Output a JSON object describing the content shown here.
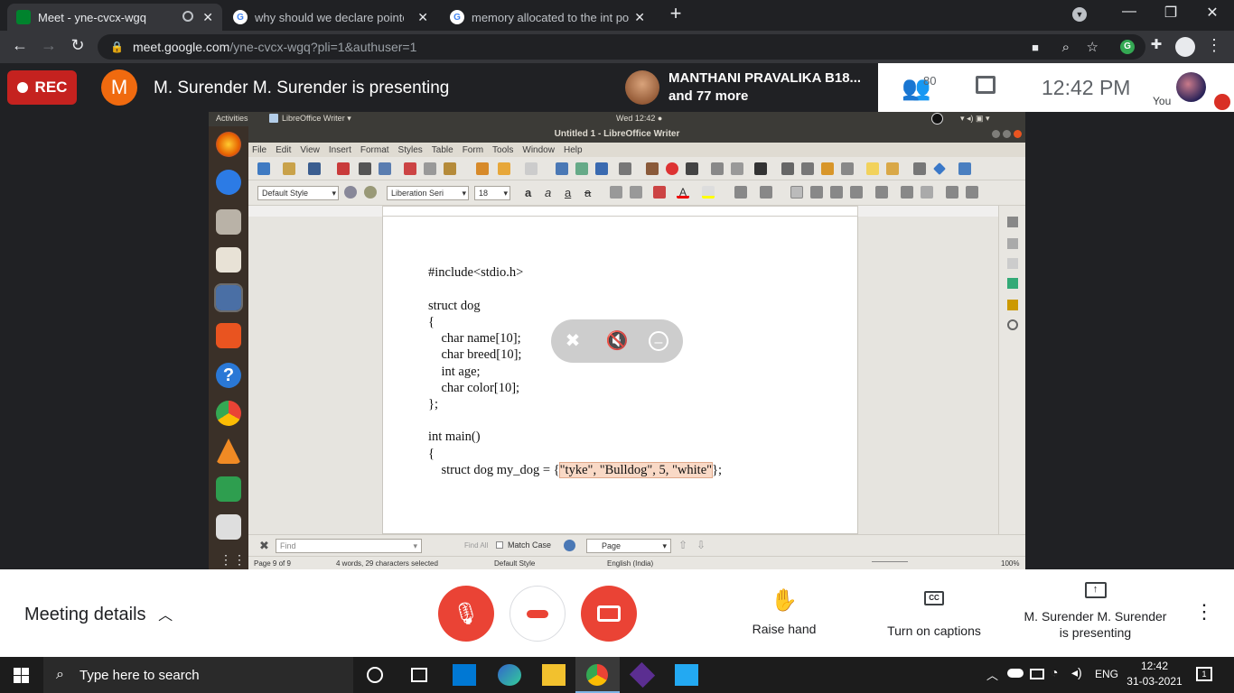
{
  "browser": {
    "tabs": [
      {
        "title": "Meet - yne-cvcx-wgq",
        "active": true
      },
      {
        "title": "why should we declare pointer a",
        "active": false
      },
      {
        "title": "memory allocated to the int poin",
        "active": false
      }
    ],
    "url_host": "meet.google.com",
    "url_path": "/yne-cvcx-wgq?pli=1&authuser=1",
    "new_tab": "+",
    "profile_initial": "G"
  },
  "meet": {
    "rec_label": "REC",
    "presenter_initial": "M",
    "presenting_text": "M. Surender M. Surender is presenting",
    "participant_name": "MANTHANI PRAVALIKA B18...",
    "participant_more": "and 77 more",
    "participant_count": "80",
    "clock": "12:42  PM",
    "you_label": "You",
    "meeting_details": "Meeting details",
    "raise_hand": "Raise hand",
    "captions": "Turn on captions",
    "presenting_line1": "M. Surender M. Surender",
    "presenting_line2": "is presenting"
  },
  "ubuntu": {
    "activities": "Activities",
    "app_menu": "LibreOffice Writer ▾",
    "datetime": "Wed 12:42 ●"
  },
  "writer": {
    "window_title": "Untitled 1 - LibreOffice Writer",
    "menu": [
      "File",
      "Edit",
      "View",
      "Insert",
      "Format",
      "Styles",
      "Table",
      "Form",
      "Tools",
      "Window",
      "Help"
    ],
    "paragraph_style": "Default Style",
    "font_name": "Liberation Seri",
    "font_size": "18",
    "code_lines": [
      "#include<stdio.h>",
      "",
      "struct dog",
      "{",
      "    char name[10];",
      "    char breed[10];",
      "    int age;",
      "    char color[10];",
      "};",
      "",
      "int main()",
      "{"
    ],
    "last_line_prefix": "    struct dog my_dog = {",
    "last_line_selected": "\"tyke\", \"Bulldog\", 5, \"white\"",
    "last_line_suffix": "};",
    "find_placeholder": "Find",
    "find_all": "Find All",
    "match_case": "Match Case",
    "find_scope": "Page",
    "status": {
      "page": "Page 9 of 9",
      "words": "4 words, 29 characters selected",
      "style": "Default Style",
      "lang": "English (India)",
      "zoom": "100%"
    }
  },
  "taskbar": {
    "search_placeholder": "Type here to search",
    "lang": "ENG",
    "time": "12:42",
    "date": "31-03-2021",
    "notifications": "1"
  }
}
